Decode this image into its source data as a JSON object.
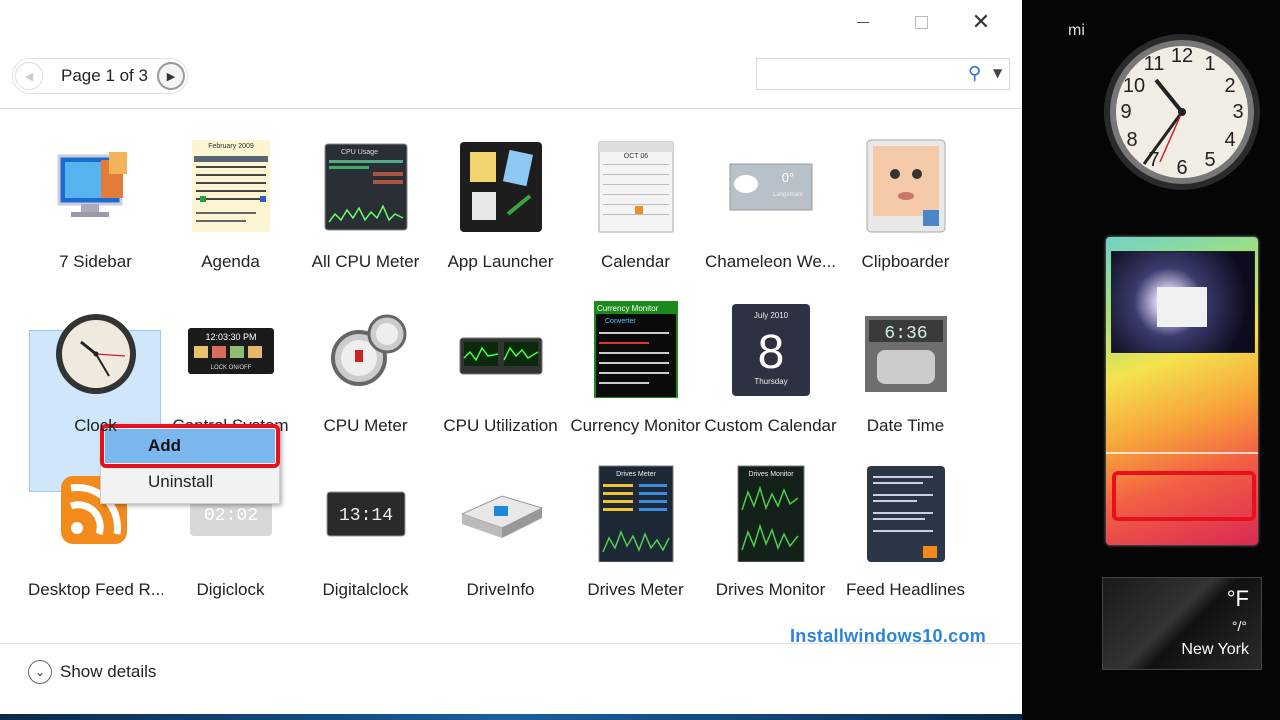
{
  "window": {
    "pager": {
      "label": "Page 1 of 3"
    },
    "search": {
      "value": "",
      "placeholder": ""
    },
    "gadgets": [
      {
        "name": "7 Sidebar",
        "icon": "sidebar-monitor-icon"
      },
      {
        "name": "Agenda",
        "icon": "agenda-calendar-icon",
        "header": "February 2009"
      },
      {
        "name": "All CPU Meter",
        "icon": "cpu-usage-icon",
        "header": "CPU Usage"
      },
      {
        "name": "App Launcher",
        "icon": "app-launcher-icon"
      },
      {
        "name": "Calendar",
        "icon": "calendar-icon",
        "header": "OCT 06"
      },
      {
        "name": "Chameleon We...",
        "icon": "weather-cloud-icon",
        "temp": "0°",
        "place": "Langemark"
      },
      {
        "name": "Clipboarder",
        "icon": "clipboard-baby-icon"
      },
      {
        "name": "Clock",
        "icon": "analog-clock-icon"
      },
      {
        "name": "Control System",
        "icon": "control-system-icon",
        "time": "12:03:30 PM",
        "sub": "LOCK ON/OFF"
      },
      {
        "name": "CPU Meter",
        "icon": "cpu-meter-gauge-icon"
      },
      {
        "name": "CPU Utilization",
        "icon": "cpu-utilization-icon"
      },
      {
        "name": "Currency Monitor",
        "icon": "currency-monitor-icon",
        "header": "Currency Monitor",
        "sub": "Converter"
      },
      {
        "name": "Custom Calendar",
        "icon": "custom-calendar-icon",
        "month": "July 2010",
        "day": "8",
        "weekday": "Thursday"
      },
      {
        "name": "Date Time",
        "icon": "date-time-icon",
        "time": "6:36"
      },
      {
        "name": "Desktop Feed R...",
        "icon": "rss-feed-icon"
      },
      {
        "name": "Digiclock",
        "icon": "digiclock-icon",
        "time": "02:02"
      },
      {
        "name": "Digitalclock",
        "icon": "digital-clock-icon",
        "time": "13:14"
      },
      {
        "name": "DriveInfo",
        "icon": "hard-drive-icon"
      },
      {
        "name": "Drives Meter",
        "icon": "drives-meter-icon",
        "header": "Drives Meter"
      },
      {
        "name": "Drives Monitor",
        "icon": "drives-monitor-icon",
        "header": "Drives Monitor"
      },
      {
        "name": "Feed Headlines",
        "icon": "feed-headlines-icon"
      }
    ],
    "context_menu": {
      "add": "Add",
      "uninstall": "Uninstall"
    },
    "show_details": "Show details",
    "watermark": "Installwindows10.com"
  },
  "sidebar": {
    "partial_text": "mi",
    "weather": {
      "unit": "°F",
      "range": "°/°",
      "city": "New York"
    }
  },
  "colors": {
    "highlight_red": "#e8101a",
    "selection_blue": "#cfe6fb",
    "menu_blue": "#7ab8ef",
    "link_blue": "#2a84d8"
  }
}
